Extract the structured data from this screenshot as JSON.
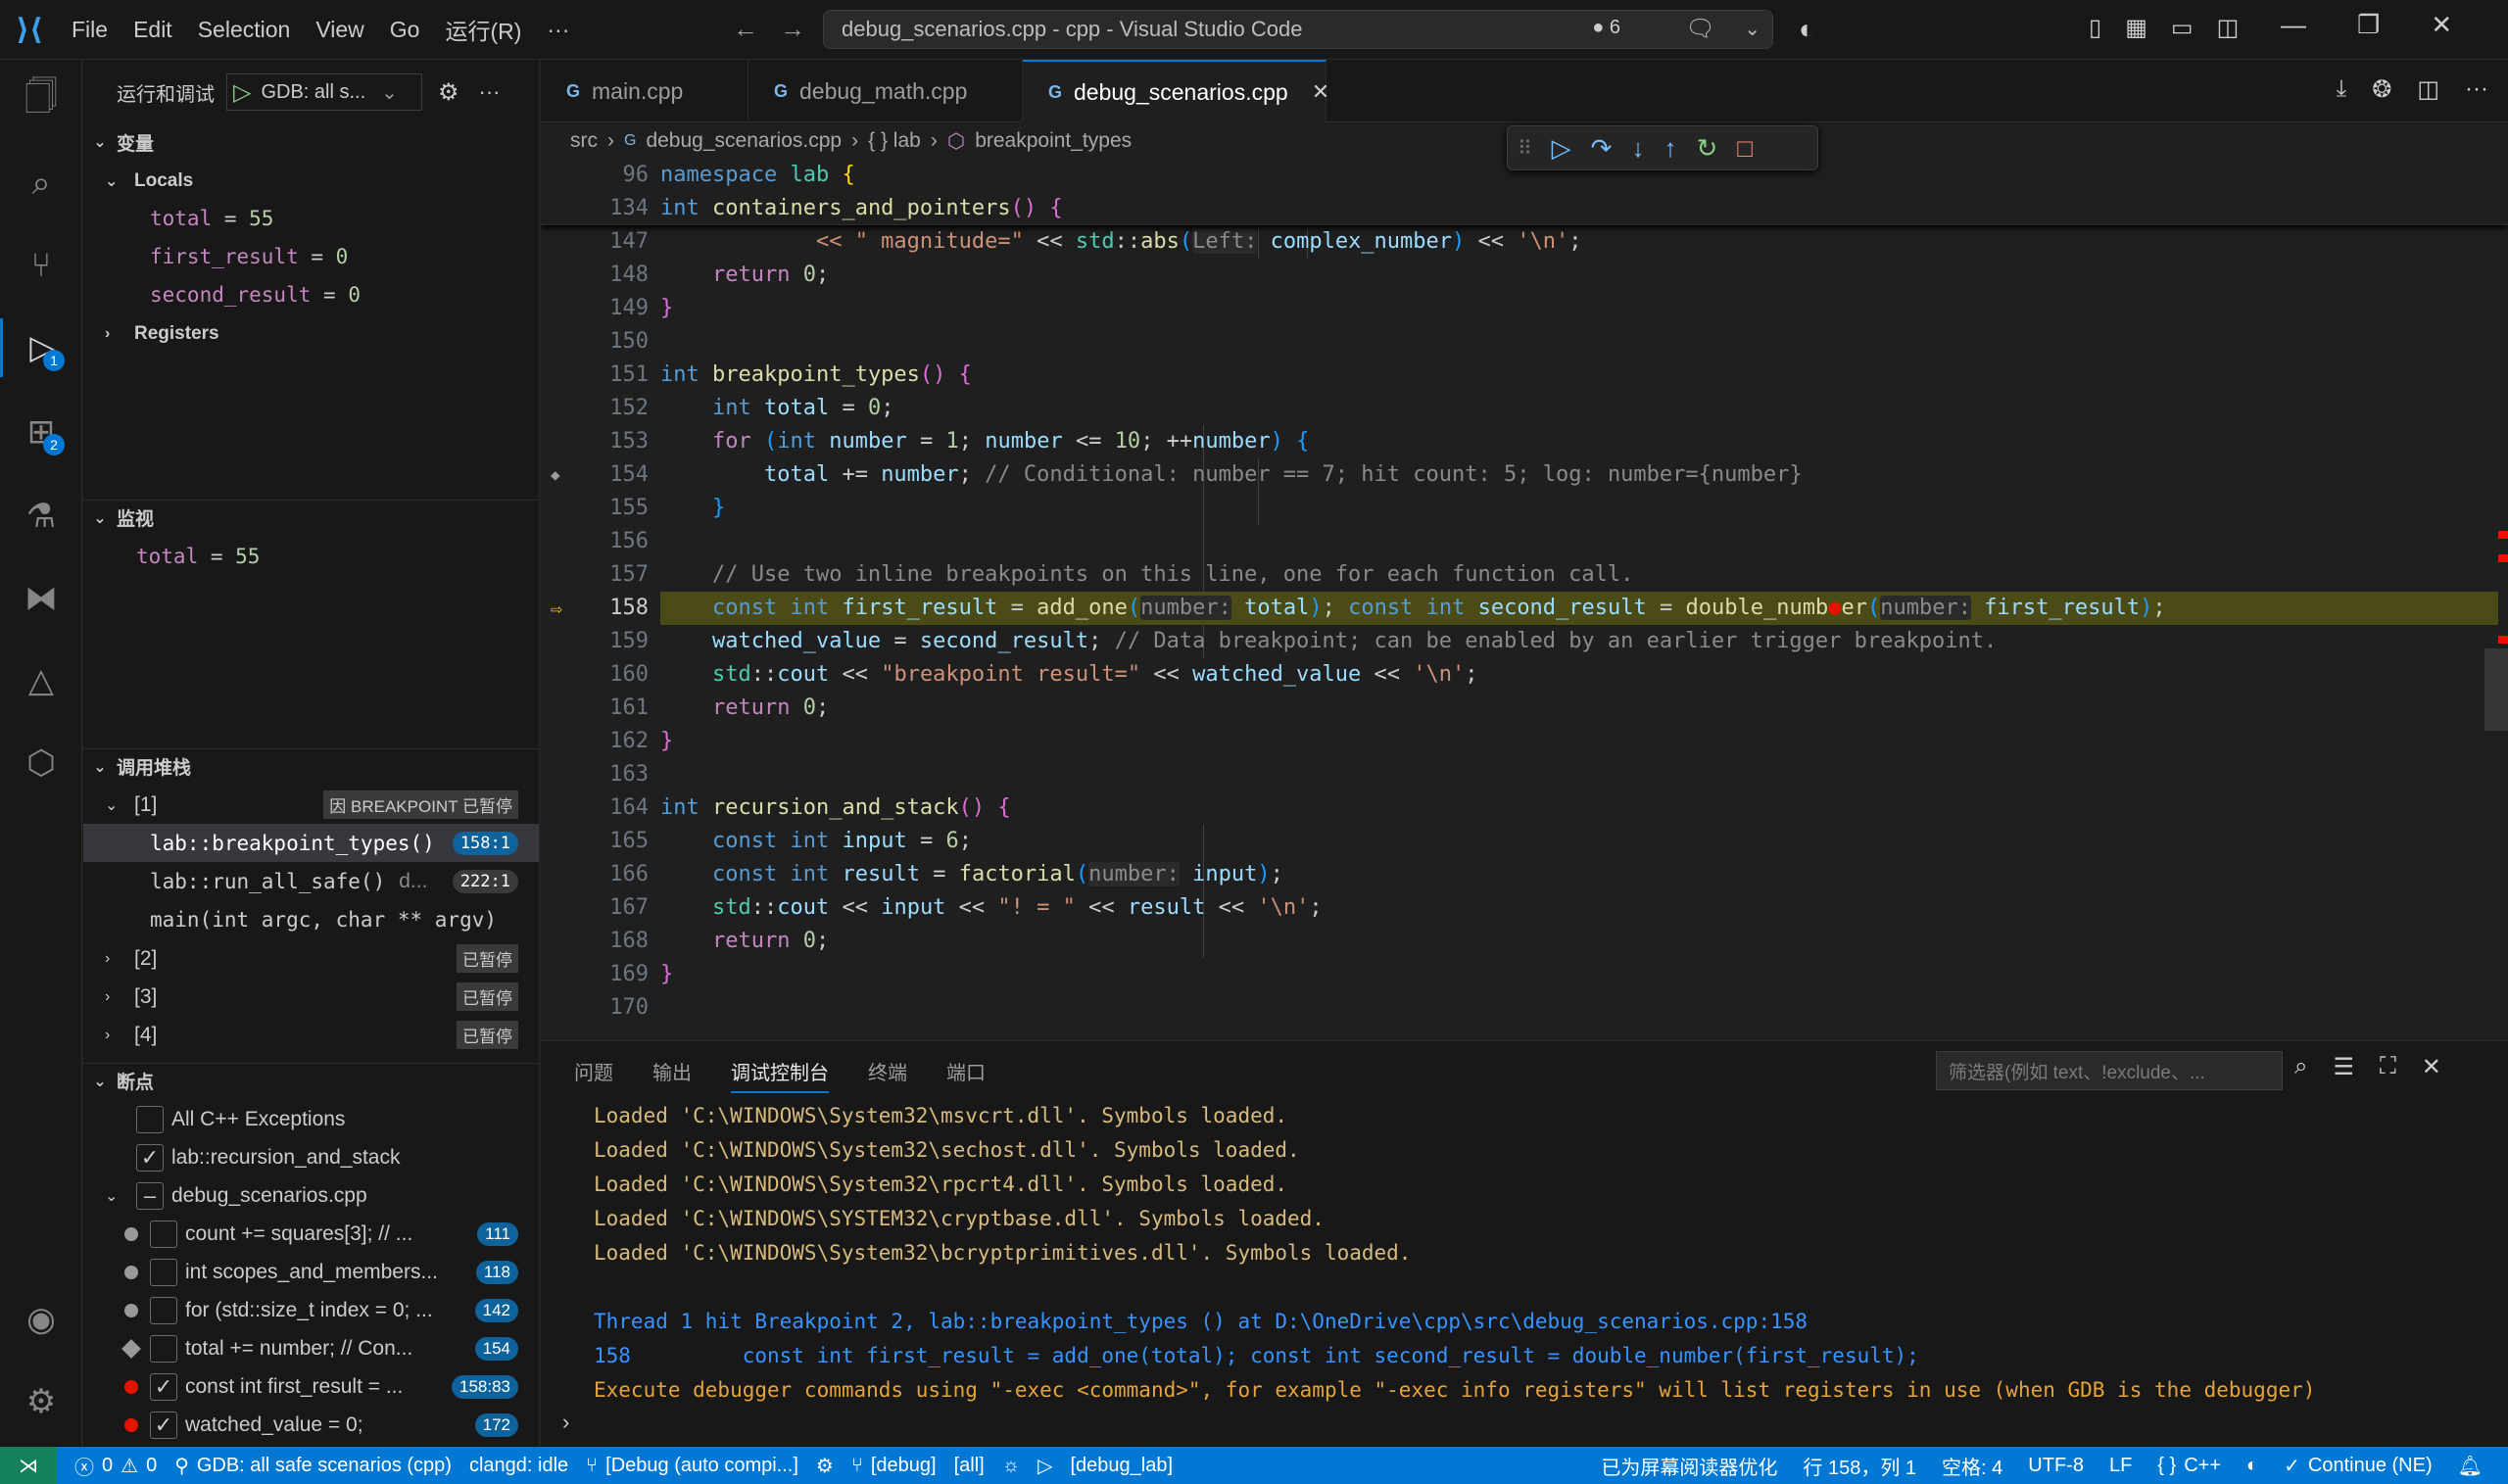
{
  "titlebar": {
    "menu": [
      "File",
      "Edit",
      "Selection",
      "View",
      "Go",
      "运行(R)",
      "···"
    ],
    "command_center": "debug_scenarios.cpp - cpp - Visual Studio Code",
    "dirty_count": "6"
  },
  "activity": {
    "debug_badge": "1",
    "extensions_badge": "2"
  },
  "sidebar": {
    "title": "运行和调试",
    "config": "GDB: all s...",
    "variables_title": "变量",
    "locals_title": "Locals",
    "locals": [
      {
        "name": "total",
        "value": "55"
      },
      {
        "name": "first_result",
        "value": "0"
      },
      {
        "name": "second_result",
        "value": "0"
      }
    ],
    "registers_title": "Registers",
    "watch_title": "监视",
    "watch": [
      {
        "name": "total",
        "value": "55"
      }
    ],
    "callstack_title": "调用堆栈",
    "thread1": "[1]",
    "thread1_tag": "因 BREAKPOINT 已暂停",
    "frames": [
      {
        "name": "lab::breakpoint_types()",
        "loc": "158:1"
      },
      {
        "name": "lab::run_all_safe()",
        "extra": "d...",
        "loc": "222:1"
      },
      {
        "name": "main(int argc, char ** argv)",
        "loc": ""
      }
    ],
    "threads": [
      {
        "name": "[2]",
        "tag": "已暂停"
      },
      {
        "name": "[3]",
        "tag": "已暂停"
      },
      {
        "name": "[4]",
        "tag": "已暂停"
      }
    ],
    "breakpoints_title": "断点",
    "bp_all_cpp": "All C++ Exceptions",
    "bp_recursion": "lab::recursion_and_stack",
    "bp_file": "debug_scenarios.cpp",
    "bp_items": [
      {
        "label": "count += squares[3]; // ...",
        "line": "111"
      },
      {
        "label": "int scopes_and_members...",
        "line": "118"
      },
      {
        "label": "for (std::size_t index = 0; ...",
        "line": "142"
      },
      {
        "label": "total += number; // Con...",
        "line": "154"
      },
      {
        "label": "const int first_result = ...",
        "line": "158:83"
      },
      {
        "label": "watched_value = 0;",
        "line": "172"
      }
    ]
  },
  "tabs": [
    {
      "label": "main.cpp"
    },
    {
      "label": "debug_math.cpp"
    },
    {
      "label": "debug_scenarios.cpp"
    }
  ],
  "breadcrumb": [
    "src",
    "debug_scenarios.cpp",
    "{ } lab",
    "breakpoint_types"
  ],
  "editor": {
    "sticky_lines": [
      {
        "n": "96",
        "text": "namespace lab {"
      },
      {
        "n": "134",
        "text": "int containers_and_pointers() {"
      }
    ],
    "line_numbers": [
      "147",
      "148",
      "149",
      "150",
      "151",
      "152",
      "153",
      "154",
      "155",
      "156",
      "157",
      "158",
      "159",
      "160",
      "161",
      "162",
      "163",
      "164",
      "165",
      "166",
      "167",
      "168",
      "169",
      "170"
    ],
    "current_line": "158"
  },
  "panel": {
    "tabs": [
      "问题",
      "输出",
      "调试控制台",
      "终端",
      "端口"
    ],
    "active_tab": "调试控制台",
    "filter_placeholder": "筛选器(例如 text、!exclude、...",
    "output": [
      {
        "text": "Loaded 'C:\\WINDOWS\\System32\\msvcrt.dll'. Symbols loaded.",
        "kind": "y"
      },
      {
        "text": "Loaded 'C:\\WINDOWS\\System32\\sechost.dll'. Symbols loaded.",
        "kind": "y"
      },
      {
        "text": "Loaded 'C:\\WINDOWS\\System32\\rpcrt4.dll'. Symbols loaded.",
        "kind": "y"
      },
      {
        "text": "Loaded 'C:\\WINDOWS\\SYSTEM32\\cryptbase.dll'. Symbols loaded.",
        "kind": "y"
      },
      {
        "text": "Loaded 'C:\\WINDOWS\\System32\\bcryptprimitives.dll'. Symbols loaded.",
        "kind": "y"
      },
      {
        "text": "",
        "kind": "y"
      },
      {
        "text": "Thread 1 hit Breakpoint 2, lab::breakpoint_types () at D:\\OneDrive\\cpp\\src\\debug_scenarios.cpp:158",
        "kind": "b"
      },
      {
        "text": "158         const int first_result = add_one(total); const int second_result = double_number(first_result);",
        "kind": "b"
      },
      {
        "text": "Execute debugger commands using \"-exec <command>\", for example \"-exec info registers\" will list registers in use (when GDB is the debugger)",
        "kind": "o"
      }
    ]
  },
  "status": {
    "errors": "0",
    "warnings": "0",
    "debug_config": "GDB: all safe scenarios (cpp)",
    "clangd": "clangd: idle",
    "build": "[Debug (auto compi...]",
    "variant": "[debug]",
    "target": "[all]",
    "launch": "[debug_lab]",
    "screen_reader": "已为屏幕阅读器优化",
    "cursor": "行 158，列 1",
    "spaces": "空格: 4",
    "encoding": "UTF-8",
    "eol": "LF",
    "language": "C++",
    "continue": "Continue (NE)"
  }
}
